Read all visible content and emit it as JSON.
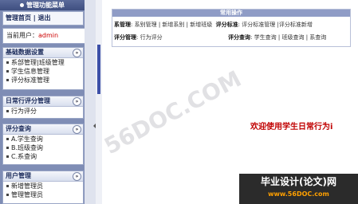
{
  "sidebar": {
    "title": "管理功能菜单",
    "top_links": {
      "home": "管理首页",
      "separator": "|",
      "logout": "退出"
    },
    "current_user_label": "当前用户：",
    "current_user": "admin",
    "sections": [
      {
        "title": "基础数据设置",
        "items": [
          "系部管理|班级管理",
          "学生信息管理",
          "评分标准管理"
        ]
      },
      {
        "title": "日常行评分管理",
        "items": [
          "行为评分"
        ]
      },
      {
        "title": "评分查询",
        "items": [
          "A.学生查询",
          "B.班级查询",
          "C.系查询"
        ]
      },
      {
        "title": "用户管理",
        "items": [
          "新增管理员",
          "管理管理员"
        ]
      }
    ]
  },
  "common_ops": {
    "header": "常用操作",
    "row1_label": "系管理",
    "row1_links": [
      "系别管理",
      "新增系别",
      "新增班级"
    ],
    "row1_label2": "评分标准",
    "row1_links2": [
      "评分标准管理",
      "|评分标准新增"
    ],
    "row2_label": "评分管理",
    "row2_links": [
      "行为评分"
    ],
    "row2_label2": "评分查询",
    "row2_links2": [
      "学生查询",
      "班级查询",
      "系查询"
    ]
  },
  "welcome_text": "欢迎使用学生日常行为i",
  "watermark": "56DOC.COM",
  "logo": {
    "line1": "毕业设计(论文)网",
    "line2": "www.56DOC.com"
  }
}
